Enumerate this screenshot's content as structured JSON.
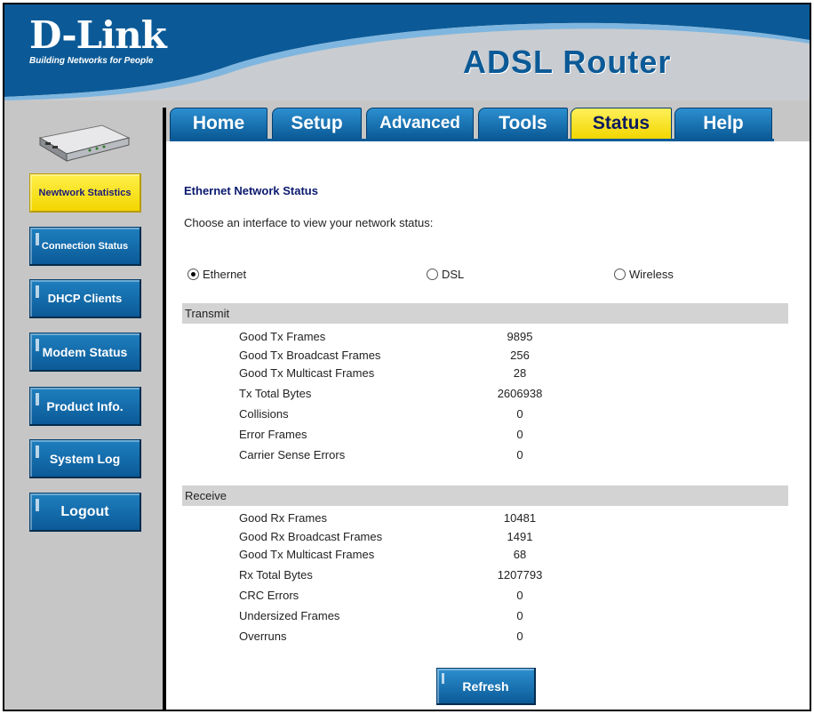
{
  "header": {
    "brand": "D-Link",
    "tagline": "Building Networks for People",
    "product": "ADSL Router"
  },
  "colors": {
    "brand_blue": "#0b5a97",
    "active_yellow": "#f2d600",
    "section_bar": "#d3d3d3",
    "title_navy": "#0b1a6e"
  },
  "tabs": [
    {
      "label": "Home",
      "active": false
    },
    {
      "label": "Setup",
      "active": false
    },
    {
      "label": "Advanced",
      "active": false
    },
    {
      "label": "Tools",
      "active": false
    },
    {
      "label": "Status",
      "active": true
    },
    {
      "label": "Help",
      "active": false
    }
  ],
  "sidebar": {
    "device_icon": "router-device-icon",
    "items": [
      {
        "label": "Newtwork Statistics",
        "active": true
      },
      {
        "label": "Connection Status",
        "active": false
      },
      {
        "label": "DHCP Clients",
        "active": false
      },
      {
        "label": "Modem Status",
        "active": false
      },
      {
        "label": "Product Info.",
        "active": false
      },
      {
        "label": "System Log",
        "active": false
      },
      {
        "label": "Logout",
        "active": false
      }
    ]
  },
  "main": {
    "title": "Ethernet Network Status",
    "instruction": "Choose an interface to view your network status:",
    "interfaces": [
      {
        "label": "Ethernet",
        "selected": true
      },
      {
        "label": "DSL",
        "selected": false
      },
      {
        "label": "Wireless",
        "selected": false
      }
    ],
    "transmit": {
      "title": "Transmit",
      "rows": [
        {
          "label": "Good Tx Frames",
          "value": "9895"
        },
        {
          "label": "Good Tx Broadcast Frames",
          "value": "256"
        },
        {
          "label": "Good Tx Multicast Frames",
          "value": "28"
        },
        {
          "label": "Tx Total Bytes",
          "value": "2606938"
        },
        {
          "label": "Collisions",
          "value": "0"
        },
        {
          "label": "Error Frames",
          "value": "0"
        },
        {
          "label": "Carrier Sense Errors",
          "value": "0"
        }
      ]
    },
    "receive": {
      "title": "Receive",
      "rows": [
        {
          "label": "Good Rx Frames",
          "value": "10481"
        },
        {
          "label": "Good Rx Broadcast Frames",
          "value": "1491"
        },
        {
          "label": "Good Tx Multicast Frames",
          "value": "68"
        },
        {
          "label": "Rx Total Bytes",
          "value": "1207793"
        },
        {
          "label": "CRC Errors",
          "value": "0"
        },
        {
          "label": "Undersized Frames",
          "value": "0"
        },
        {
          "label": "Overruns",
          "value": "0"
        }
      ]
    },
    "refresh_label": "Refresh"
  }
}
